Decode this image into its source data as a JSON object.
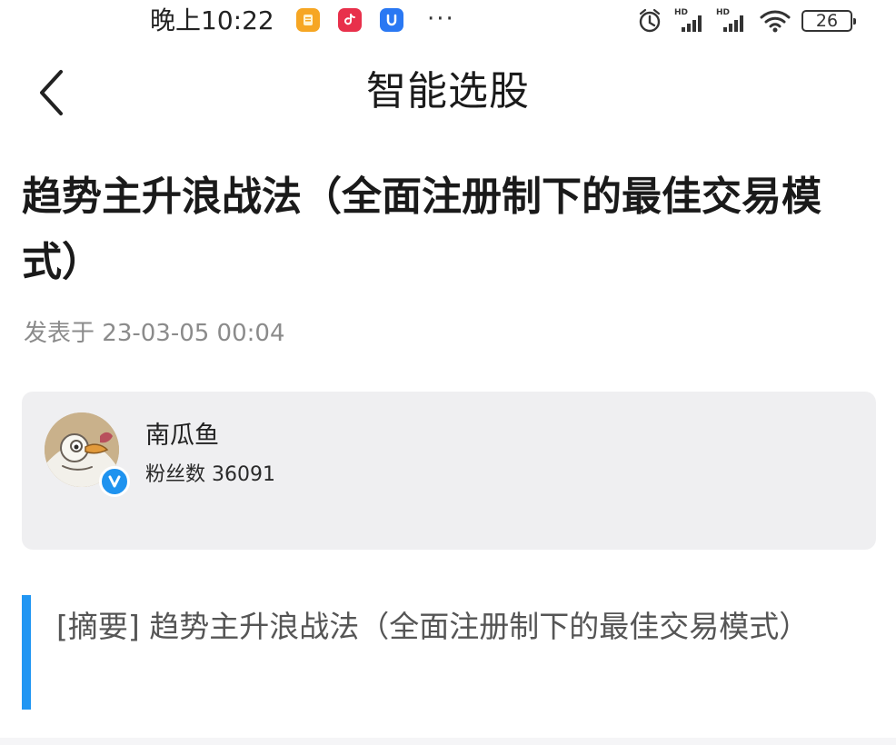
{
  "status_bar": {
    "time": "晚上10:22",
    "more": "···",
    "battery": "26",
    "signal_label": "HD",
    "icons": [
      "notes-app-icon",
      "tiktok-app-icon",
      "u-app-icon",
      "alarm-icon",
      "signal-icon",
      "wifi-icon",
      "battery-icon"
    ]
  },
  "header": {
    "back_icon": "chevron-left-icon",
    "title": "智能选股"
  },
  "article": {
    "title": "趋势主升浪战法（全面注册制下的最佳交易模式）",
    "published_label": "发表于",
    "published_at": "23-03-05 00:04"
  },
  "author": {
    "name": "南瓜鱼",
    "followers_label": "粉丝数",
    "followers": "36091",
    "verified": true,
    "avatar_icon": "bird-avatar",
    "verified_icon": "verified-v-icon"
  },
  "summary": {
    "label": "[摘要]",
    "text": "趋势主升浪战法（全面注册制下的最佳交易模式）"
  },
  "colors": {
    "accent": "#2196f3",
    "card_background": "#efeff1",
    "verified": "#1f93ef"
  }
}
